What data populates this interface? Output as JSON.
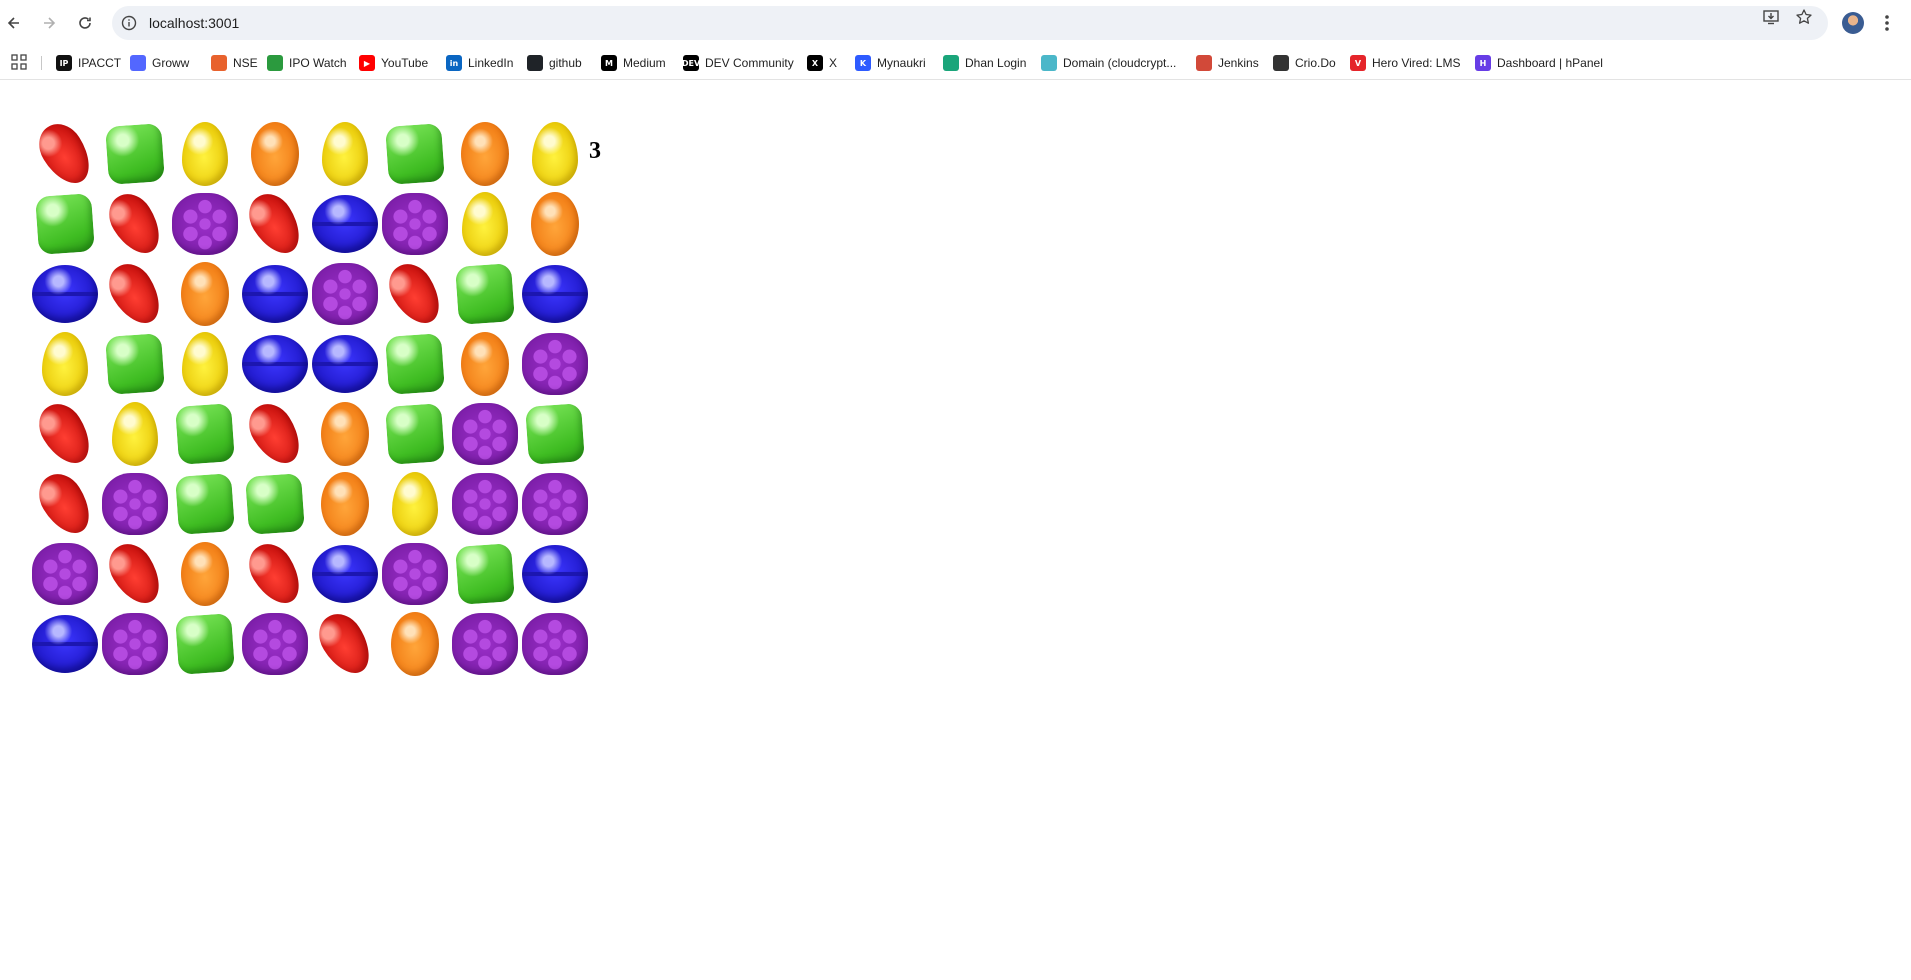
{
  "browser": {
    "url": "localhost:3001",
    "icons": {
      "back": "arrow-left-icon",
      "forward": "arrow-right-icon",
      "reload": "reload-icon",
      "site_info": "info-icon",
      "install": "install-app-icon",
      "bookmark": "star-icon",
      "menu": "more-vert-icon"
    }
  },
  "bookmarks": [
    {
      "label": "IPACCT",
      "icon": "ipacct-favicon",
      "color": "#111111",
      "glyph": "IP"
    },
    {
      "label": "Groww",
      "icon": "groww-favicon",
      "color": "#5367ff",
      "glyph": ""
    },
    {
      "label": "NSE",
      "icon": "nse-favicon",
      "color": "#e8622d",
      "glyph": ""
    },
    {
      "label": "IPO Watch",
      "icon": "ipo-watch-favicon",
      "color": "#2b9a3e",
      "glyph": ""
    },
    {
      "label": "YouTube",
      "icon": "youtube-favicon",
      "color": "#ff0000",
      "glyph": "▶"
    },
    {
      "label": "LinkedIn",
      "icon": "linkedin-favicon",
      "color": "#0a66c2",
      "glyph": "in"
    },
    {
      "label": "github",
      "icon": "github-favicon",
      "color": "#1f2328",
      "glyph": ""
    },
    {
      "label": "Medium",
      "icon": "medium-favicon",
      "color": "#000000",
      "glyph": "M"
    },
    {
      "label": "DEV Community",
      "icon": "dev-favicon",
      "color": "#000000",
      "glyph": "DEV"
    },
    {
      "label": "X",
      "icon": "x-favicon",
      "color": "#000000",
      "glyph": "X"
    },
    {
      "label": "Mynaukri",
      "icon": "mynaukri-favicon",
      "color": "#2e5bff",
      "glyph": "K"
    },
    {
      "label": "Dhan Login",
      "icon": "dhan-favicon",
      "color": "#1aa57a",
      "glyph": ""
    },
    {
      "label": "Domain (cloudcrypt...",
      "icon": "domain-favicon",
      "color": "#4bb7c9",
      "glyph": ""
    },
    {
      "label": "Jenkins",
      "icon": "jenkins-favicon",
      "color": "#d24939",
      "glyph": ""
    },
    {
      "label": "Crio.Do",
      "icon": "crio-favicon",
      "color": "#333333",
      "glyph": ""
    },
    {
      "label": "Hero Vired: LMS",
      "icon": "herovired-favicon",
      "color": "#e5252a",
      "glyph": "V"
    },
    {
      "label": "Dashboard | hPanel",
      "icon": "hpanel-favicon",
      "color": "#673de6",
      "glyph": "H"
    }
  ],
  "game": {
    "score": "3",
    "board": [
      [
        "red",
        "green",
        "yellow",
        "orange",
        "yellow",
        "green",
        "orange",
        "yellow"
      ],
      [
        "green",
        "red",
        "purple",
        "red",
        "blue",
        "purple",
        "yellow",
        "orange"
      ],
      [
        "blue",
        "red",
        "orange",
        "blue",
        "purple",
        "red",
        "green",
        "blue"
      ],
      [
        "yellow",
        "green",
        "yellow",
        "blue",
        "blue",
        "green",
        "orange",
        "purple"
      ],
      [
        "red",
        "yellow",
        "green",
        "red",
        "orange",
        "green",
        "purple",
        "green"
      ],
      [
        "red",
        "purple",
        "green",
        "green",
        "orange",
        "yellow",
        "purple",
        "purple"
      ],
      [
        "purple",
        "red",
        "orange",
        "red",
        "blue",
        "purple",
        "green",
        "blue"
      ],
      [
        "blue",
        "purple",
        "green",
        "purple",
        "red",
        "orange",
        "purple",
        "purple"
      ]
    ],
    "candy_names": {
      "red": "red-candy-icon",
      "green": "green-candy-icon",
      "yellow": "yellow-candy-icon",
      "orange": "orange-candy-icon",
      "blue": "blue-candy-icon",
      "purple": "purple-candy-icon"
    }
  }
}
